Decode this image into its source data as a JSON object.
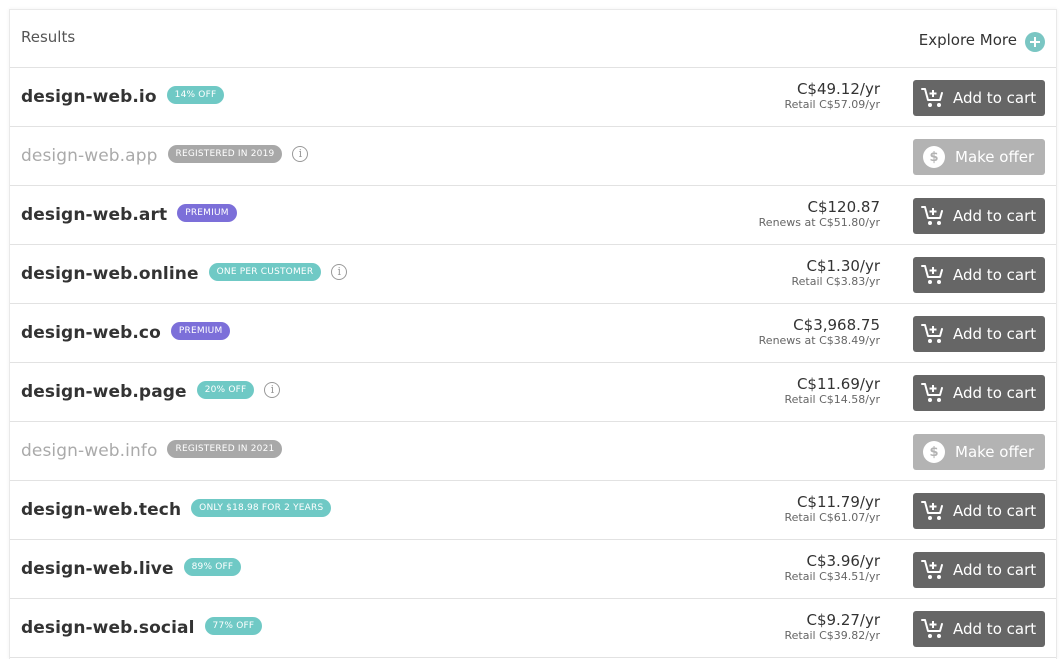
{
  "header": {
    "title": "Results",
    "explore_label": "Explore More"
  },
  "rows": [
    {
      "domain": "design-web.io",
      "badge": "14% OFF",
      "badge_color": "teal",
      "info": false,
      "price": "C$49.12/yr",
      "sub": "Retail C$57.09/yr",
      "action": "Add to cart",
      "available": true
    },
    {
      "domain": "design-web.app",
      "badge": "REGISTERED IN 2019",
      "badge_color": "gray",
      "info": true,
      "price": "",
      "sub": "",
      "action": "Make offer",
      "available": false
    },
    {
      "domain": "design-web.art",
      "badge": "PREMIUM",
      "badge_color": "purple",
      "info": false,
      "price": "C$120.87",
      "sub": "Renews at C$51.80/yr",
      "action": "Add to cart",
      "available": true
    },
    {
      "domain": "design-web.online",
      "badge": "ONE PER CUSTOMER",
      "badge_color": "teal",
      "info": true,
      "price": "C$1.30/yr",
      "sub": "Retail C$3.83/yr",
      "action": "Add to cart",
      "available": true
    },
    {
      "domain": "design-web.co",
      "badge": "PREMIUM",
      "badge_color": "purple",
      "info": false,
      "price": "C$3,968.75",
      "sub": "Renews at C$38.49/yr",
      "action": "Add to cart",
      "available": true
    },
    {
      "domain": "design-web.page",
      "badge": "20% OFF",
      "badge_color": "teal",
      "info": true,
      "price": "C$11.69/yr",
      "sub": "Retail C$14.58/yr",
      "action": "Add to cart",
      "available": true
    },
    {
      "domain": "design-web.info",
      "badge": "REGISTERED IN 2021",
      "badge_color": "gray",
      "info": false,
      "price": "",
      "sub": "",
      "action": "Make offer",
      "available": false
    },
    {
      "domain": "design-web.tech",
      "badge": "ONLY $18.98 FOR 2 YEARS",
      "badge_color": "teal",
      "info": false,
      "price": "C$11.79/yr",
      "sub": "Retail C$61.07/yr",
      "action": "Add to cart",
      "available": true
    },
    {
      "domain": "design-web.live",
      "badge": "89% OFF",
      "badge_color": "teal",
      "info": false,
      "price": "C$3.96/yr",
      "sub": "Retail C$34.51/yr",
      "action": "Add to cart",
      "available": true
    },
    {
      "domain": "design-web.social",
      "badge": "77% OFF",
      "badge_color": "teal",
      "info": false,
      "price": "C$9.27/yr",
      "sub": "Retail C$39.82/yr",
      "action": "Add to cart",
      "available": true
    }
  ],
  "colors": {
    "teal": "#6fc9c5",
    "purple": "#7c6fd9",
    "gray": "#a8a8a8",
    "button": "#666666",
    "button_disabled": "#b3b3b3"
  },
  "icons": {
    "explore": "plus-circle-icon",
    "info": "info-icon",
    "cart": "cart-icon",
    "offer": "dollar-chat-icon"
  }
}
